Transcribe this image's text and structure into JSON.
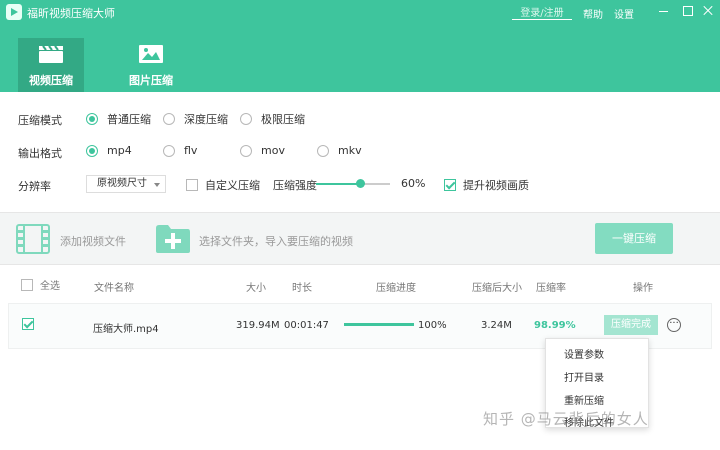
{
  "window": {
    "title": "福昕视频压缩大师",
    "login_label": "登录/注册",
    "help_label": "帮助",
    "settings_label": "设置"
  },
  "tabs": [
    {
      "label": "视频压缩",
      "active": true
    },
    {
      "label": "图片压缩",
      "active": false
    }
  ],
  "settings": {
    "mode_label": "压缩模式",
    "mode_options": [
      "普通压缩",
      "深度压缩",
      "极限压缩"
    ],
    "mode_selected": "普通压缩",
    "format_label": "输出格式",
    "format_options": [
      "mp4",
      "flv",
      "mov",
      "mkv"
    ],
    "format_selected": "mp4",
    "resolution_label": "分辨率",
    "resolution_value": "原视频尺寸",
    "custom_label": "自定义压缩",
    "custom_checked": false,
    "strength_label": "压缩强度",
    "strength_value": "60%",
    "strength_fraction": 0.6,
    "enhance_label": "提升视频画质",
    "enhance_checked": true
  },
  "addbar": {
    "add_file_label": "添加视频文件",
    "add_folder_label": "选择文件夹，导入要压缩的视频",
    "onekey_label": "一键压缩"
  },
  "table": {
    "headers": {
      "select_all": "全选",
      "name": "文件名称",
      "size": "大小",
      "duration": "时长",
      "progress": "压缩进度",
      "after_size": "压缩后大小",
      "ratio": "压缩率",
      "action": "操作"
    },
    "rows": [
      {
        "checked": true,
        "name": "压缩大师.mp4",
        "size": "319.94M",
        "duration": "00:01:47",
        "progress_text": "100%",
        "progress_fraction": 1.0,
        "after_size": "3.24M",
        "ratio": "98.99%",
        "action_label": "压缩完成"
      }
    ]
  },
  "menu": {
    "items": [
      "设置参数",
      "打开目录",
      "重新压缩",
      "移除此文件"
    ]
  },
  "watermark": "知乎 @马云背后的女人",
  "colors": {
    "brand": "#3ec59d",
    "brand_dark": "#33a985",
    "ratio_text": "#3ec59d"
  }
}
